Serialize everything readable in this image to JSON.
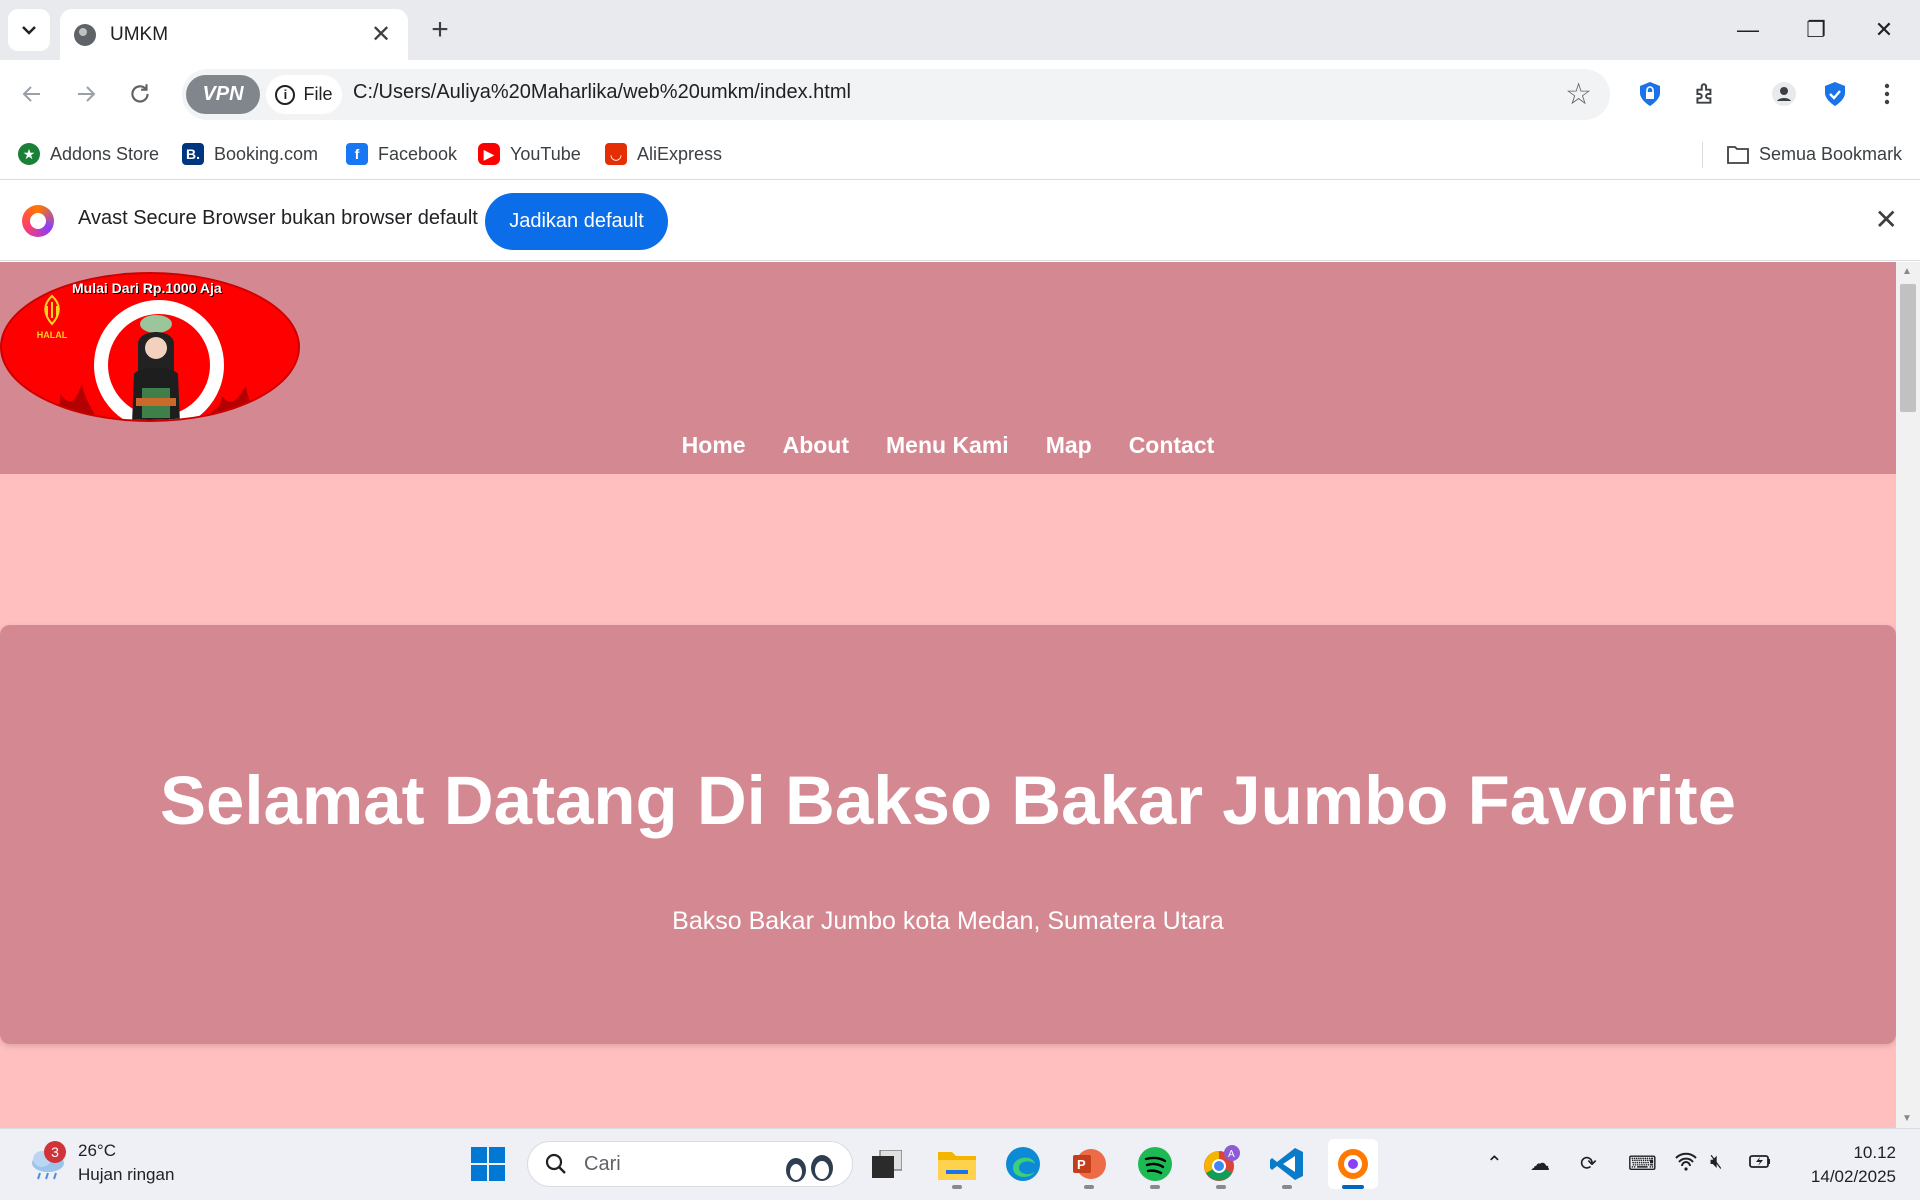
{
  "browser": {
    "tab_title": "UMKM",
    "vpn_label": "VPN",
    "chip_label": "File",
    "url": "C:/Users/Auliya%20Maharlika/web%20umkm/index.html",
    "bookmarks": [
      {
        "label": "Addons Store",
        "color": "#1a7f37"
      },
      {
        "label": "Booking.com",
        "color": "#003580"
      },
      {
        "label": "Facebook",
        "color": "#1877f2"
      },
      {
        "label": "YouTube",
        "color": "#ff0000"
      },
      {
        "label": "AliExpress",
        "color": "#e62e04"
      }
    ],
    "all_bookmarks": "Semua Bookmark",
    "infobar": {
      "text": "Avast Secure Browser bukan browser default",
      "button": "Jadikan default"
    }
  },
  "site": {
    "logo": {
      "tagline": "Mulai Dari Rp.1000 Aja",
      "halal": "HALAL"
    },
    "nav": [
      "Home",
      "About",
      "Menu Kami",
      "Map",
      "Contact"
    ],
    "hero": {
      "title": "Selamat Datang Di Bakso Bakar Jumbo Favorite",
      "subtitle": "Bakso Bakar Jumbo kota Medan, Sumatera Utara"
    },
    "colors": {
      "header": "#d48891",
      "background": "#ffbfbf"
    }
  },
  "taskbar": {
    "weather": {
      "temp": "26°C",
      "desc": "Hujan ringan",
      "badge": "3"
    },
    "search_placeholder": "Cari",
    "time": "10.12",
    "date": "14/02/2025"
  }
}
